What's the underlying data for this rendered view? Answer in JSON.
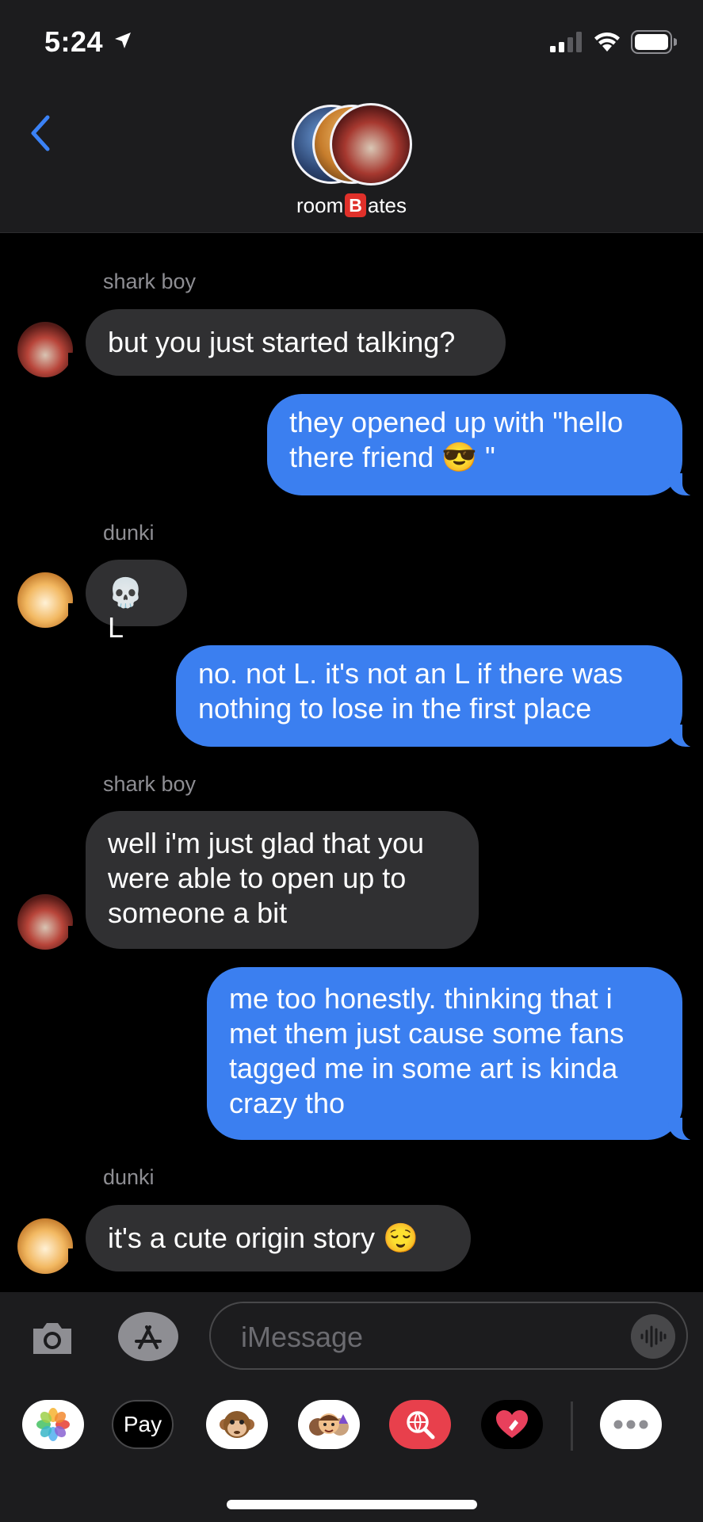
{
  "status_bar": {
    "time": "5:24"
  },
  "header": {
    "group_name_prefix": "room",
    "group_name_badge": "B",
    "group_name_suffix": "ates"
  },
  "messages": [
    {
      "sender": "shark boy"
    },
    {
      "text": "but you just started talking?"
    },
    {
      "line1": "they opened up with \"hello",
      "line2": "there friend ",
      "emoji": "😎",
      "tail": " \""
    },
    {
      "sender": "dunki"
    },
    {
      "emoji": "💀",
      "text": " L"
    },
    {
      "line1": "no. not L. it's not an L if there was",
      "line2": "nothing to lose in the first place"
    },
    {
      "sender": "shark boy"
    },
    {
      "line1": "well i'm just glad that you",
      "line2": "were able to open up to",
      "line3": "someone a bit"
    },
    {
      "line1": "me too honestly. thinking that i",
      "line2": "met them just cause some fans",
      "line3": "tagged me in some art is kinda",
      "line4": "crazy tho"
    },
    {
      "sender": "dunki"
    },
    {
      "text": "it's a cute origin story ",
      "emoji": "😌"
    }
  ],
  "compose": {
    "placeholder": "iMessage"
  },
  "tray": {
    "apple_pay_label": "Pay",
    "apple_glyph": ""
  },
  "colors": {
    "outgoing": "#3b7ff0",
    "incoming": "#303032",
    "background": "#000000",
    "bar": "#1c1c1e"
  }
}
